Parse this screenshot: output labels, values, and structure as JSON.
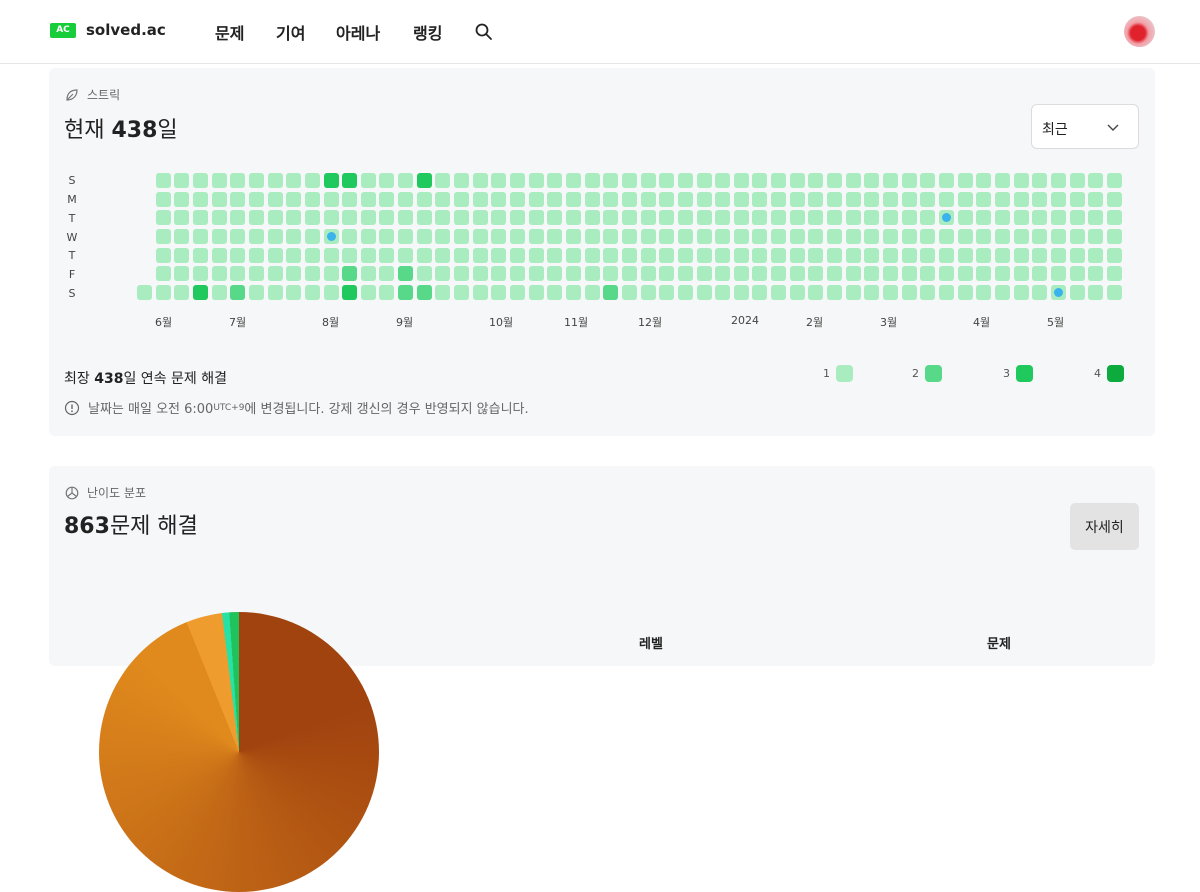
{
  "nav": {
    "logo_badge": "AC",
    "logo_text": "solved.ac",
    "menu": [
      "문제",
      "기여",
      "아레나",
      "랭킹"
    ]
  },
  "streak": {
    "section_label": "스트릭",
    "title_prefix": "현재 ",
    "title_value": "438",
    "title_suffix": "일",
    "range_select": "최근",
    "day_labels": [
      "S",
      "M",
      "T",
      "W",
      "T",
      "F",
      "S"
    ],
    "month_labels": [
      "6월",
      "7월",
      "8월",
      "9월",
      "10월",
      "11월",
      "12월",
      "2024",
      "2월",
      "3월",
      "4월",
      "5월"
    ],
    "longest_prefix": "최장 ",
    "longest_value": "438",
    "longest_suffix": "일 연속 문제 해결",
    "legend": [
      "1",
      "2",
      "3",
      "4"
    ],
    "legend_colors": [
      "#a8ecc0",
      "#58d98a",
      "#1fc95e",
      "#0daa3d"
    ],
    "notice_pre": "날짜는 매일 오전 6:00",
    "notice_tz": "UTC+9",
    "notice_post": "에 변경됩니다. 강제 갱신의 경우 반영되지 않습니다."
  },
  "difficulty": {
    "section_label": "난이도 분포",
    "title_value": "863",
    "title_suffix": "문제 해결",
    "detail_button": "자세히",
    "table_headers": [
      "레벨",
      "문제"
    ]
  }
}
